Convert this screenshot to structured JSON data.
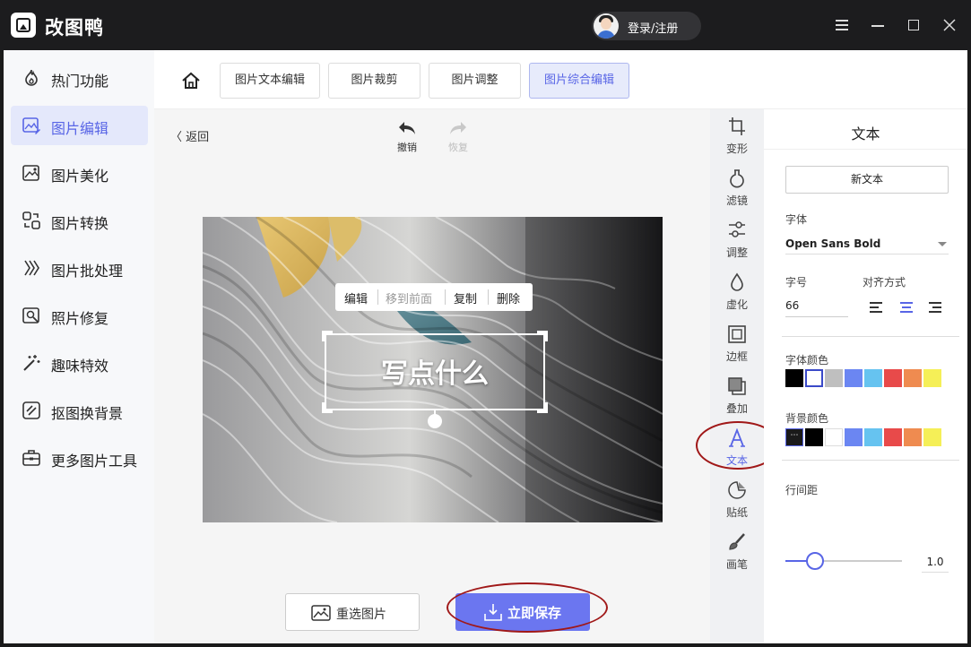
{
  "app": {
    "title": "改图鸭",
    "login_label": "登录/注册"
  },
  "sidebar": {
    "items": [
      {
        "label": "热门功能",
        "icon": "flame-icon"
      },
      {
        "label": "图片编辑",
        "icon": "image-edit-icon",
        "active": true
      },
      {
        "label": "图片美化",
        "icon": "image-beautify-icon"
      },
      {
        "label": "图片转换",
        "icon": "image-convert-icon"
      },
      {
        "label": "图片批处理",
        "icon": "batch-icon"
      },
      {
        "label": "照片修复",
        "icon": "photo-repair-icon"
      },
      {
        "label": "趣味特效",
        "icon": "magic-wand-icon"
      },
      {
        "label": "抠图换背景",
        "icon": "cutout-icon"
      },
      {
        "label": "更多图片工具",
        "icon": "toolbox-icon"
      }
    ]
  },
  "tabs": [
    {
      "label": "图片文本编辑"
    },
    {
      "label": "图片裁剪"
    },
    {
      "label": "图片调整"
    },
    {
      "label": "图片综合编辑",
      "active": true
    }
  ],
  "editor": {
    "back_label": "返回",
    "undo_label": "撤销",
    "redo_label": "恢复",
    "context_menu": {
      "edit": "编辑",
      "bring_front": "移到前面",
      "copy": "复制",
      "delete": "删除"
    },
    "text_box_content": "写点什么",
    "reselect_label": "重选图片",
    "save_label": "立即保存"
  },
  "tools": [
    {
      "label": "变形",
      "icon": "crop-icon"
    },
    {
      "label": "滤镜",
      "icon": "filter-icon"
    },
    {
      "label": "调整",
      "icon": "adjust-icon"
    },
    {
      "label": "虚化",
      "icon": "blur-icon"
    },
    {
      "label": "边框",
      "icon": "border-icon"
    },
    {
      "label": "叠加",
      "icon": "overlay-icon"
    },
    {
      "label": "文本",
      "icon": "text-icon",
      "active": true
    },
    {
      "label": "贴纸",
      "icon": "sticker-icon"
    },
    {
      "label": "画笔",
      "icon": "brush-icon"
    }
  ],
  "panel": {
    "title": "文本",
    "new_text_label": "新文本",
    "font_label": "字体",
    "font_value": "Open Sans Bold",
    "size_label": "字号",
    "size_value": "66",
    "align_label": "对齐方式",
    "font_color_label": "字体颜色",
    "bg_color_label": "背景颜色",
    "line_height_label": "行间距",
    "line_height_value": "1.0",
    "line_height_fraction": 0.25,
    "font_colors": [
      "#000000",
      "#ffffff",
      "#bfbfbf",
      "#6b86f2",
      "#66c3f0",
      "#e84a4a",
      "#ef8b50",
      "#f5ef57"
    ],
    "bg_colors": [
      "#000000",
      "#ffffff",
      "#6b86f2",
      "#66c3f0",
      "#e84a4a",
      "#ef8b50",
      "#f5ef57"
    ],
    "accent": "#5865e6"
  }
}
